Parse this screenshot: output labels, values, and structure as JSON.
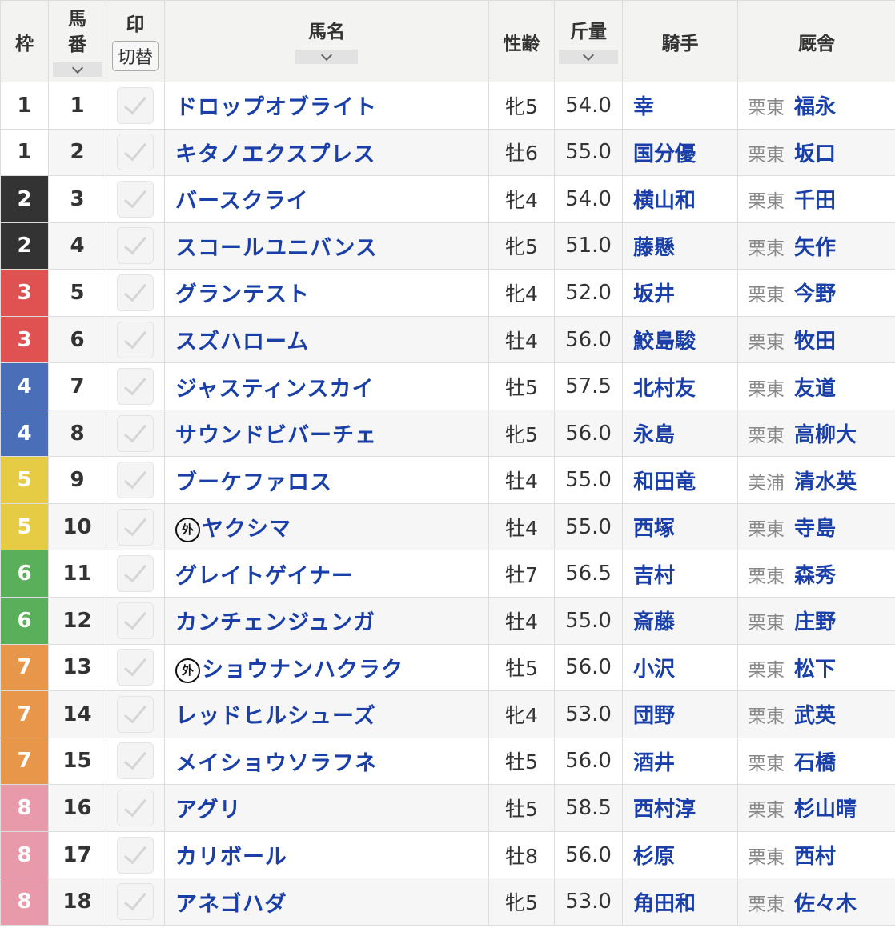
{
  "header": {
    "waku": "枠",
    "umaban_top": "馬",
    "umaban_bottom": "番",
    "mark": "印",
    "switch": "切替",
    "name": "馬名",
    "sexage": "性齢",
    "weight": "斤量",
    "jockey": "騎手",
    "stable": "厩舎"
  },
  "colors": {
    "1": {
      "bg": "#ffffff",
      "fg": "#333333"
    },
    "2": {
      "bg": "#333333",
      "fg": "#ffffff"
    },
    "3": {
      "bg": "#e05252",
      "fg": "#ffffff"
    },
    "4": {
      "bg": "#4a6fb8",
      "fg": "#ffffff"
    },
    "5": {
      "bg": "#e6cc45",
      "fg": "#ffffff"
    },
    "6": {
      "bg": "#5aaf5a",
      "fg": "#ffffff"
    },
    "7": {
      "bg": "#e8974a",
      "fg": "#ffffff"
    },
    "8": {
      "bg": "#e89aab",
      "fg": "#ffffff"
    },
    "name_text": "#1a3fa8"
  },
  "foreign_mark": "外",
  "rows": [
    {
      "waku": "1",
      "umaban": "1",
      "foreign": false,
      "name": "ドロップオブライト",
      "sexage": "牝5",
      "weight": "54.0",
      "jockey": "幸",
      "region": "栗東",
      "trainer": "福永"
    },
    {
      "waku": "1",
      "umaban": "2",
      "foreign": false,
      "name": "キタノエクスプレス",
      "sexage": "牡6",
      "weight": "55.0",
      "jockey": "国分優",
      "region": "栗東",
      "trainer": "坂口"
    },
    {
      "waku": "2",
      "umaban": "3",
      "foreign": false,
      "name": "バースクライ",
      "sexage": "牝4",
      "weight": "54.0",
      "jockey": "横山和",
      "region": "栗東",
      "trainer": "千田"
    },
    {
      "waku": "2",
      "umaban": "4",
      "foreign": false,
      "name": "スコールユニバンス",
      "sexage": "牝5",
      "weight": "51.0",
      "jockey": "藤懸",
      "region": "栗東",
      "trainer": "矢作"
    },
    {
      "waku": "3",
      "umaban": "5",
      "foreign": false,
      "name": "グランテスト",
      "sexage": "牝4",
      "weight": "52.0",
      "jockey": "坂井",
      "region": "栗東",
      "trainer": "今野"
    },
    {
      "waku": "3",
      "umaban": "6",
      "foreign": false,
      "name": "スズハローム",
      "sexage": "牡4",
      "weight": "56.0",
      "jockey": "鮫島駿",
      "region": "栗東",
      "trainer": "牧田"
    },
    {
      "waku": "4",
      "umaban": "7",
      "foreign": false,
      "name": "ジャスティンスカイ",
      "sexage": "牡5",
      "weight": "57.5",
      "jockey": "北村友",
      "region": "栗東",
      "trainer": "友道"
    },
    {
      "waku": "4",
      "umaban": "8",
      "foreign": false,
      "name": "サウンドビバーチェ",
      "sexage": "牝5",
      "weight": "56.0",
      "jockey": "永島",
      "region": "栗東",
      "trainer": "高柳大"
    },
    {
      "waku": "5",
      "umaban": "9",
      "foreign": false,
      "name": "ブーケファロス",
      "sexage": "牡4",
      "weight": "55.0",
      "jockey": "和田竜",
      "region": "美浦",
      "trainer": "清水英"
    },
    {
      "waku": "5",
      "umaban": "10",
      "foreign": true,
      "name": "ヤクシマ",
      "sexage": "牡4",
      "weight": "55.0",
      "jockey": "西塚",
      "region": "栗東",
      "trainer": "寺島"
    },
    {
      "waku": "6",
      "umaban": "11",
      "foreign": false,
      "name": "グレイトゲイナー",
      "sexage": "牡7",
      "weight": "56.5",
      "jockey": "吉村",
      "region": "栗東",
      "trainer": "森秀"
    },
    {
      "waku": "6",
      "umaban": "12",
      "foreign": false,
      "name": "カンチェンジュンガ",
      "sexage": "牡4",
      "weight": "55.0",
      "jockey": "斎藤",
      "region": "栗東",
      "trainer": "庄野"
    },
    {
      "waku": "7",
      "umaban": "13",
      "foreign": true,
      "name": "ショウナンハクラク",
      "sexage": "牡5",
      "weight": "56.0",
      "jockey": "小沢",
      "region": "栗東",
      "trainer": "松下"
    },
    {
      "waku": "7",
      "umaban": "14",
      "foreign": false,
      "name": "レッドヒルシューズ",
      "sexage": "牝4",
      "weight": "53.0",
      "jockey": "団野",
      "region": "栗東",
      "trainer": "武英"
    },
    {
      "waku": "7",
      "umaban": "15",
      "foreign": false,
      "name": "メイショウソラフネ",
      "sexage": "牡5",
      "weight": "56.0",
      "jockey": "酒井",
      "region": "栗東",
      "trainer": "石橋"
    },
    {
      "waku": "8",
      "umaban": "16",
      "foreign": false,
      "name": "アグリ",
      "sexage": "牡5",
      "weight": "58.5",
      "jockey": "西村淳",
      "region": "栗東",
      "trainer": "杉山晴"
    },
    {
      "waku": "8",
      "umaban": "17",
      "foreign": false,
      "name": "カリボール",
      "sexage": "牡8",
      "weight": "56.0",
      "jockey": "杉原",
      "region": "栗東",
      "trainer": "西村"
    },
    {
      "waku": "8",
      "umaban": "18",
      "foreign": false,
      "name": "アネゴハダ",
      "sexage": "牝5",
      "weight": "53.0",
      "jockey": "角田和",
      "region": "栗東",
      "trainer": "佐々木"
    }
  ]
}
